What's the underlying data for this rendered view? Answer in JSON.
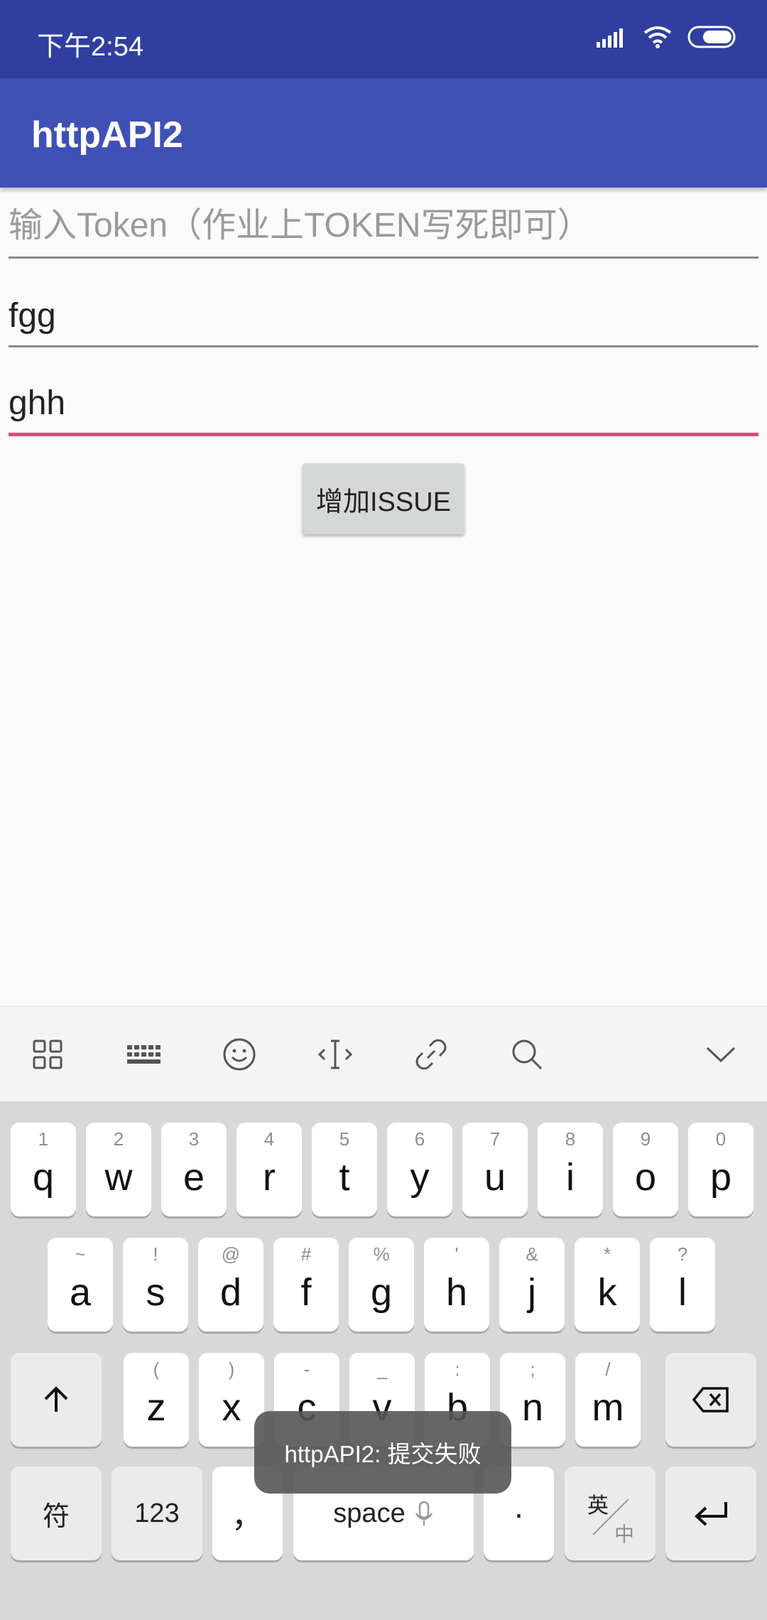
{
  "status_bar": {
    "time": "下午2:54"
  },
  "app_bar": {
    "title": "httpAPI2"
  },
  "form": {
    "token_placeholder": "输入Token（作业上TOKEN写死即可）",
    "title_value": "fgg",
    "body_value": "ghh",
    "submit_label": "增加ISSUE"
  },
  "keyboard": {
    "row1": [
      {
        "hint": "1",
        "label": "q"
      },
      {
        "hint": "2",
        "label": "w"
      },
      {
        "hint": "3",
        "label": "e"
      },
      {
        "hint": "4",
        "label": "r"
      },
      {
        "hint": "5",
        "label": "t"
      },
      {
        "hint": "6",
        "label": "y"
      },
      {
        "hint": "7",
        "label": "u"
      },
      {
        "hint": "8",
        "label": "i"
      },
      {
        "hint": "9",
        "label": "o"
      },
      {
        "hint": "0",
        "label": "p"
      }
    ],
    "row2": [
      {
        "hint": "~",
        "label": "a"
      },
      {
        "hint": "!",
        "label": "s"
      },
      {
        "hint": "@",
        "label": "d"
      },
      {
        "hint": "#",
        "label": "f"
      },
      {
        "hint": "%",
        "label": "g"
      },
      {
        "hint": "'",
        "label": "h"
      },
      {
        "hint": "&",
        "label": "j"
      },
      {
        "hint": "*",
        "label": "k"
      },
      {
        "hint": "?",
        "label": "l"
      }
    ],
    "row3": [
      {
        "hint": "(",
        "label": "z"
      },
      {
        "hint": ")",
        "label": "x"
      },
      {
        "hint": "-",
        "label": "c"
      },
      {
        "hint": "_",
        "label": "v"
      },
      {
        "hint": ":",
        "label": "b"
      },
      {
        "hint": ";",
        "label": "n"
      },
      {
        "hint": "/",
        "label": "m"
      }
    ],
    "symbols_label": "符",
    "numbers_label": "123",
    "comma_label": "，",
    "space_label": "space",
    "period_label": "·",
    "lang_top": "英",
    "lang_bottom": "中"
  },
  "toast": {
    "message": "httpAPI2: 提交失败"
  }
}
